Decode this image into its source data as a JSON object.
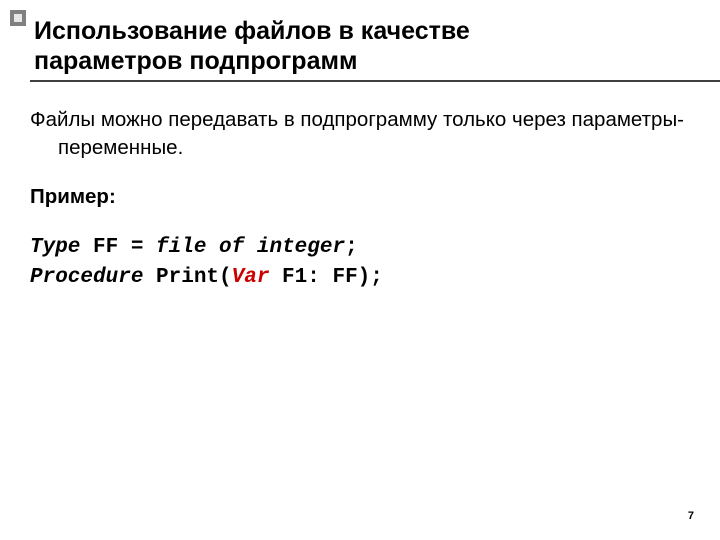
{
  "title_line1": "Использование файлов в качестве",
  "title_line2": "параметров подпрограмм",
  "paragraph": "Файлы можно передавать в подпрограмму только через параметры-переменные.",
  "example_label": "Пример:",
  "code": {
    "l1a": "Type",
    "l1b": " FF = ",
    "l1c": "file of integer",
    "l1d": ";",
    "l2a": "Procedure",
    "l2b": " Print(",
    "l2c": "Var",
    "l2d": " F1: FF);"
  },
  "page_number": "7"
}
